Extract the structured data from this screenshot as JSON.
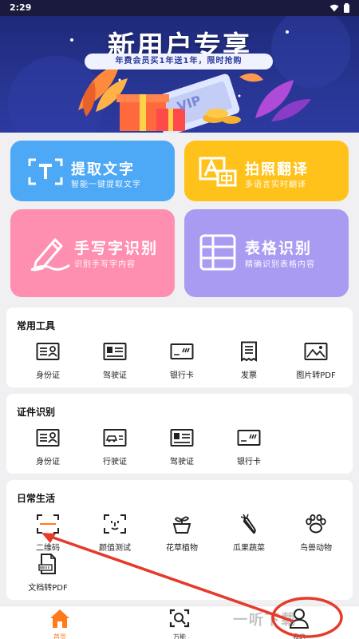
{
  "status": {
    "time": "2:29"
  },
  "banner": {
    "title": "新用户专享",
    "subtitle": "年费会员买1年送1年，限时抢购",
    "ticket_text": "VIP"
  },
  "cards": [
    {
      "title": "提取文字",
      "subtitle": "智能一键提取文字",
      "icon": "text-extract-icon",
      "color": "#4da8f5"
    },
    {
      "title": "拍照翻译",
      "subtitle": "多语言实时翻译",
      "icon": "photo-translate-icon",
      "color": "#ffc21a"
    },
    {
      "title": "手写字识别",
      "subtitle": "识别手写字内容",
      "icon": "pen-icon",
      "color": "#ff8fb0"
    },
    {
      "title": "表格识别",
      "subtitle": "精确识别表格内容",
      "icon": "table-icon",
      "color": "#a99bf2"
    }
  ],
  "sections": {
    "common_tools": {
      "title": "常用工具",
      "items": [
        "身份证",
        "驾驶证",
        "银行卡",
        "发票",
        "图片转PDF"
      ]
    },
    "id_recognition": {
      "title": "证件识别",
      "items": [
        "身份证",
        "行驶证",
        "驾驶证",
        "银行卡"
      ]
    },
    "daily_life": {
      "title": "日常生活",
      "items": [
        "二维码",
        "颜值测试",
        "花草植物",
        "瓜果蔬菜",
        "鸟兽动物",
        "文档转PDF"
      ]
    }
  },
  "nav": [
    {
      "label": "首页",
      "icon": "home-icon",
      "active": true
    },
    {
      "label": "万能",
      "icon": "scan-icon",
      "active": false
    },
    {
      "label": "我的",
      "icon": "user-icon",
      "active": false
    }
  ],
  "watermark": "一听下载",
  "colors": {
    "accent": "#ff7a1a",
    "annotation": "#e53b2a"
  }
}
